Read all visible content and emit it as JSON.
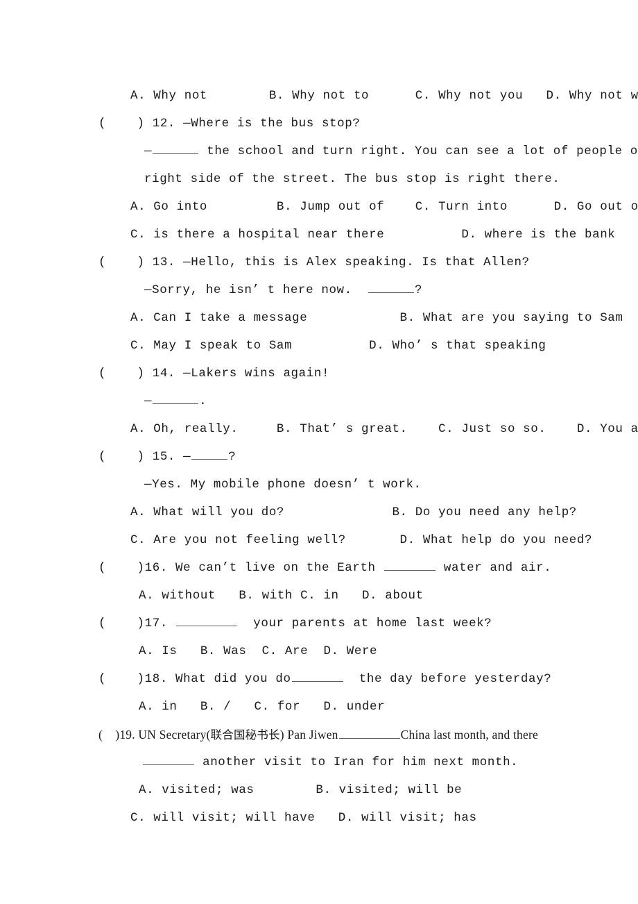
{
  "document": {
    "type": "english-multiple-choice-exam",
    "lines": [
      {
        "id": "q11-options",
        "indent": "ind-opt",
        "text": "A. Why not        B. Why not to      C. Why not you   D. Why not we"
      },
      {
        "id": "q12-stem",
        "indent": "ind-q",
        "text": "(    ) 12. —Where is the bus stop?"
      },
      {
        "id": "q12-dialogue-a",
        "indent": "ind-cont",
        "pre": "—",
        "blank": "b-md",
        "post": " the school and turn right. You can see a lot of people on the"
      },
      {
        "id": "q12-dialogue-b",
        "indent": "ind-cont",
        "text": "right side of the street. The bus stop is right there."
      },
      {
        "id": "q12-options-ab",
        "indent": "ind-opt",
        "text": "A. Go into         B. Jump out of    C. Turn into      D. Go out of"
      },
      {
        "id": "q12-options-cd",
        "indent": "ind-opt",
        "text": "C. is there a hospital near there          D. where is the bank"
      },
      {
        "id": "q13-stem",
        "indent": "ind-q",
        "text": "(    ) 13. —Hello, this is Alex speaking. Is that Allen?"
      },
      {
        "id": "q13-dialogue",
        "indent": "ind-cont",
        "pre": "—Sorry, he isn’ t here now.  ",
        "blank": "b-md",
        "post": "?"
      },
      {
        "id": "q13-options-ab",
        "indent": "ind-opt",
        "text": "A. Can I take a message            B. What are you saying to Sam"
      },
      {
        "id": "q13-options-cd",
        "indent": "ind-opt",
        "text": "C. May I speak to Sam          D. Who’ s that speaking"
      },
      {
        "id": "q14-stem",
        "indent": "ind-q",
        "text": "(    ) 14. —Lakers wins again!"
      },
      {
        "id": "q14-dialogue",
        "indent": "ind-cont",
        "pre": "—",
        "blank": "b-md",
        "post": "."
      },
      {
        "id": "q14-options",
        "indent": "ind-opt",
        "text": "A. Oh, really.     B. That’ s great.    C. Just so so.    D. You are right."
      },
      {
        "id": "q15-stem",
        "indent": "ind-q",
        "pre": "(    ) 15. —",
        "blank": "b-sm",
        "post": "?"
      },
      {
        "id": "q15-dialogue",
        "indent": "ind-cont",
        "text": "—Yes. My mobile phone doesn’ t work."
      },
      {
        "id": "q15-options-ab",
        "indent": "ind-opt",
        "text": "A. What will you do?              B. Do you need any help?"
      },
      {
        "id": "q15-options-cd",
        "indent": "ind-opt",
        "text": "C. Are you not feeling well?       D. What help do you need?"
      },
      {
        "id": "q16-stem",
        "indent": "ind-q",
        "pre": "(    )16. We can’t live on the Earth ",
        "blank": "b-lg",
        "post": " water and air."
      },
      {
        "id": "q16-options",
        "indent": "ind-opt2",
        "text": "A. without   B. with C. in   D. about"
      },
      {
        "id": "q17-stem",
        "indent": "ind-q",
        "pre": "(    )17. ",
        "blank": "b-xl",
        "post": "  your parents at home last week?"
      },
      {
        "id": "q17-options",
        "indent": "ind-opt2",
        "text": "A. Is   B. Was  C. Are  D. Were"
      },
      {
        "id": "q18-stem",
        "indent": "ind-q",
        "pre": "(    )18. What did you do",
        "blank": "b-lg",
        "post": "  the day before yesterday?"
      },
      {
        "id": "q18-options",
        "indent": "ind-opt2",
        "text": "A. in   B. /   C. for   D. under"
      },
      {
        "id": "q19-stem",
        "indent": "ind-q",
        "cjk": true,
        "pre": "(    )19. UN Secretary(",
        "cjk_text": "联合国秘书长",
        "mid": ") Pan Jiwen",
        "blank": "b-xl",
        "post": "China last month, and there"
      },
      {
        "id": "q19-stem-cont",
        "indent": "ind-cont2",
        "pre": "",
        "blank": "b-lg",
        "post": " another visit to Iran for him next month."
      },
      {
        "id": "q19-options-ab",
        "indent": "ind-opt2",
        "text": "A. visited; was        B. visited; will be"
      },
      {
        "id": "q19-options-cd",
        "indent": "ind-opt",
        "text": "C. will visit; will have   D. will visit; has"
      }
    ]
  }
}
